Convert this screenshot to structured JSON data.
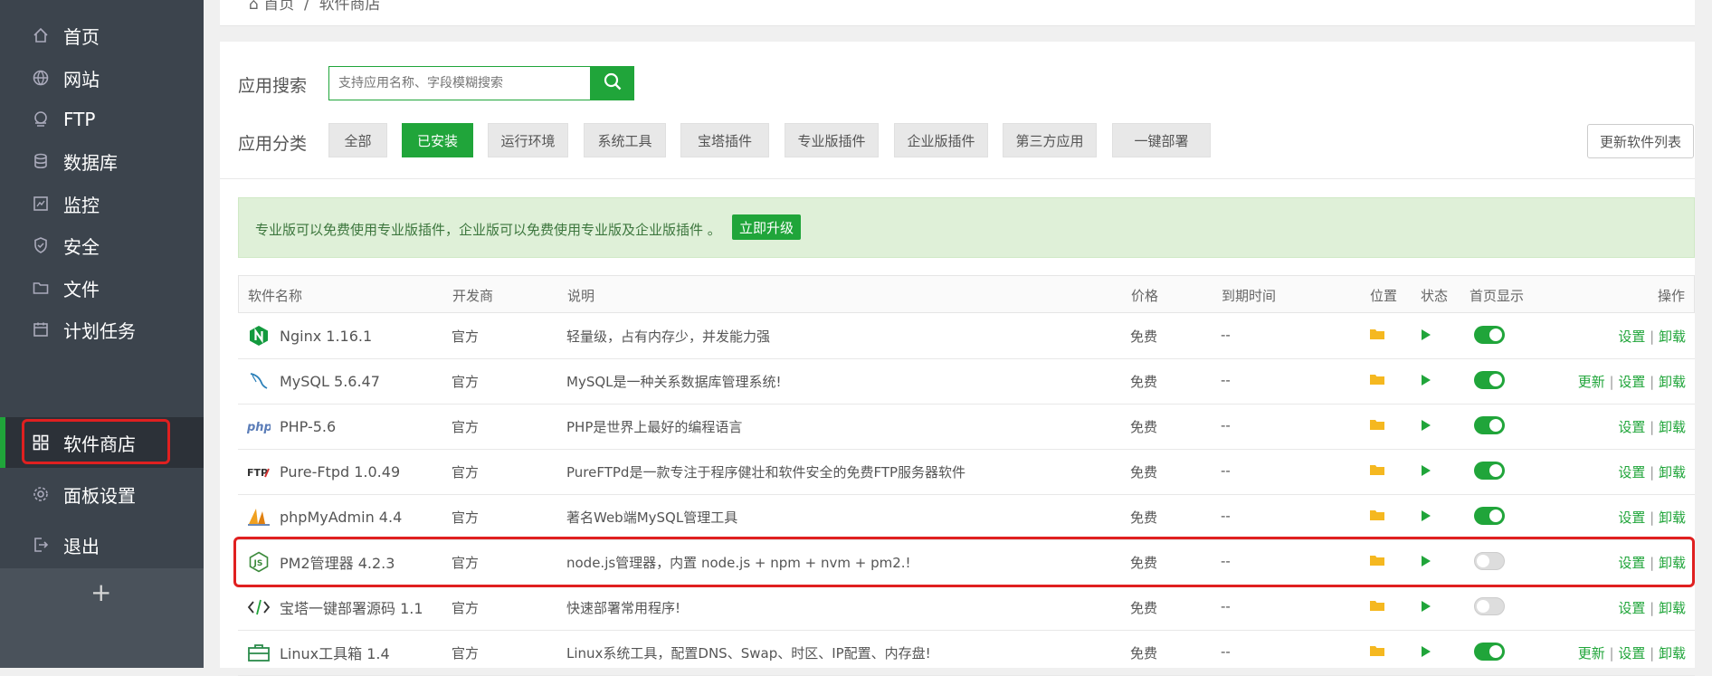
{
  "sidebar": {
    "items": [
      {
        "label": "首页",
        "icon": "home-icon"
      },
      {
        "label": "网站",
        "icon": "globe-icon"
      },
      {
        "label": "FTP",
        "icon": "ftp-icon"
      },
      {
        "label": "数据库",
        "icon": "database-icon"
      },
      {
        "label": "监控",
        "icon": "monitor-icon"
      },
      {
        "label": "安全",
        "icon": "shield-icon"
      },
      {
        "label": "文件",
        "icon": "folder-icon"
      },
      {
        "label": "计划任务",
        "icon": "calendar-icon"
      },
      {
        "label": "软件商店",
        "icon": "grid-icon"
      },
      {
        "label": "面板设置",
        "icon": "gear-icon"
      },
      {
        "label": "退出",
        "icon": "logout-icon"
      }
    ],
    "add_label": "+"
  },
  "breadcrumb": {
    "home": "首页",
    "sep": "/",
    "current": "软件商店"
  },
  "search": {
    "label": "应用搜索",
    "placeholder": "支持应用名称、字段模糊搜索"
  },
  "categories": {
    "label": "应用分类",
    "items": [
      "全部",
      "已安装",
      "运行环境",
      "系统工具",
      "宝塔插件",
      "专业版插件",
      "企业版插件",
      "第三方应用",
      "一键部署"
    ],
    "active": "已安装"
  },
  "refresh_label": "更新软件列表",
  "notice": {
    "text": "专业版可以免费使用专业版插件，企业版可以免费使用专业版及企业版插件 。",
    "button": "立即升级"
  },
  "table": {
    "headers": [
      "软件名称",
      "开发商",
      "说明",
      "价格",
      "到期时间",
      "位置",
      "状态",
      "首页显示",
      "操作"
    ],
    "rows": [
      {
        "name": "Nginx 1.16.1",
        "dev": "官方",
        "desc": "轻量级，占有内存少，并发能力强",
        "price": "免费",
        "expire": "--",
        "home_show": true,
        "ops": [
          "设置",
          "卸载"
        ],
        "logo": "nginx-logo"
      },
      {
        "name": "MySQL 5.6.47",
        "dev": "官方",
        "desc": "MySQL是一种关系数据库管理系统!",
        "price": "免费",
        "expire": "--",
        "home_show": true,
        "ops": [
          "更新",
          "设置",
          "卸载"
        ],
        "logo": "mysql-logo"
      },
      {
        "name": "PHP-5.6",
        "dev": "官方",
        "desc": "PHP是世界上最好的编程语言",
        "price": "免费",
        "expire": "--",
        "home_show": true,
        "ops": [
          "设置",
          "卸载"
        ],
        "logo": "php-logo"
      },
      {
        "name": "Pure-Ftpd 1.0.49",
        "dev": "官方",
        "desc": "PureFTPd是一款专注于程序健壮和软件安全的免费FTP服务器软件",
        "price": "免费",
        "expire": "--",
        "home_show": true,
        "ops": [
          "设置",
          "卸载"
        ],
        "logo": "ftp-logo"
      },
      {
        "name": "phpMyAdmin 4.4",
        "dev": "官方",
        "desc": "著名Web端MySQL管理工具",
        "price": "免费",
        "expire": "--",
        "home_show": true,
        "ops": [
          "设置",
          "卸载"
        ],
        "logo": "phpmyadmin-logo"
      },
      {
        "name": "PM2管理器 4.2.3",
        "dev": "官方",
        "desc": "node.js管理器，内置 node.js + npm + nvm + pm2.!",
        "price": "免费",
        "expire": "--",
        "home_show": false,
        "ops": [
          "设置",
          "卸载"
        ],
        "logo": "nodejs-logo"
      },
      {
        "name": "宝塔一键部署源码 1.1",
        "dev": "官方",
        "desc": "快速部署常用程序!",
        "price": "免费",
        "expire": "--",
        "home_show": false,
        "ops": [
          "设置",
          "卸载"
        ],
        "logo": "code-logo"
      },
      {
        "name": "Linux工具箱 1.4",
        "dev": "官方",
        "desc": "Linux系统工具，配置DNS、Swap、时区、IP配置、内存盘!",
        "price": "免费",
        "expire": "--",
        "home_show": true,
        "ops": [
          "更新",
          "设置",
          "卸载"
        ],
        "logo": "toolbox-logo"
      }
    ]
  },
  "colors": {
    "accent": "#20a53a",
    "sidebar_bg": "#3c444d",
    "highlight": "#e02020"
  }
}
